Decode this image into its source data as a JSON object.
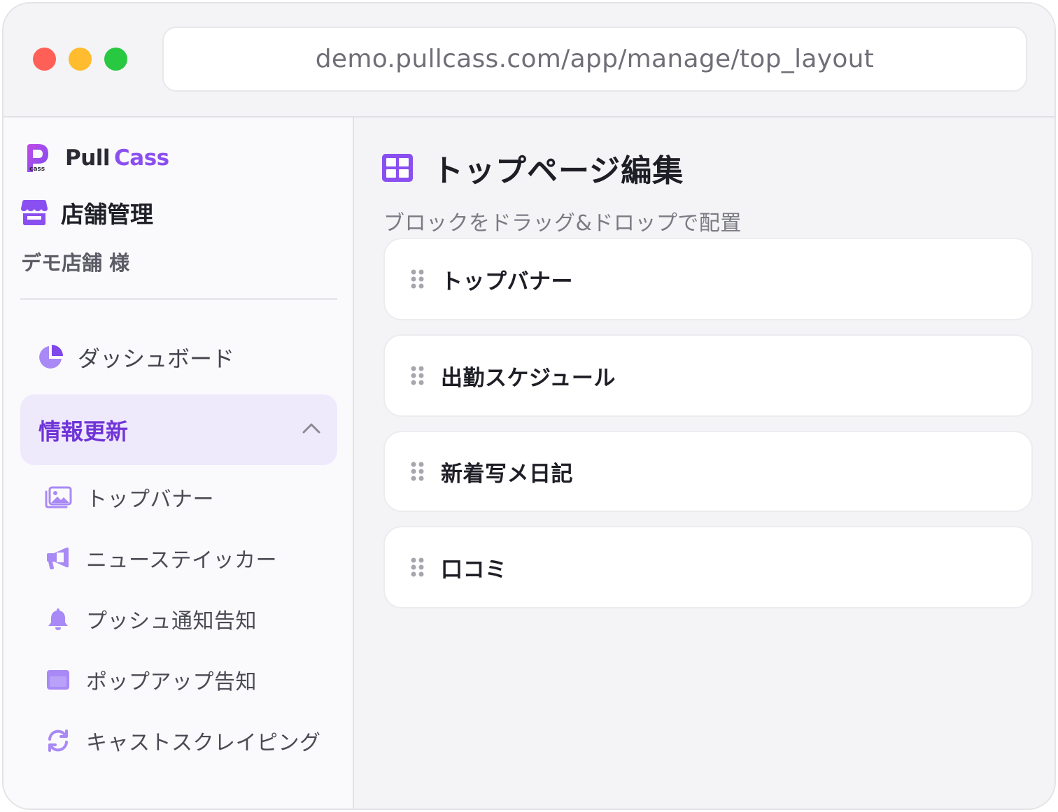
{
  "browser": {
    "url": "demo.pullcass.com/app/manage/top_layout"
  },
  "sidebar": {
    "brand": {
      "pull": "Pull",
      "cass": "Cass",
      "logo_icon": "pullcass-logo",
      "logo_caption": "cass"
    },
    "store_title": "店舗管理",
    "store_user": "デモ店舗 様",
    "dashboard": {
      "label": "ダッシュボード",
      "icon": "pie-chart-icon"
    },
    "group": {
      "label": "情報更新",
      "expanded": true,
      "icon": "chevron-up-icon"
    },
    "items": [
      {
        "label": "トップバナー",
        "icon": "images-icon"
      },
      {
        "label": "ニューステイッカー",
        "icon": "megaphone-icon"
      },
      {
        "label": "プッシュ通知告知",
        "icon": "bell-icon"
      },
      {
        "label": "ポップアップ告知",
        "icon": "window-icon"
      },
      {
        "label": "キャストスクレイピング",
        "icon": "sync-icon"
      }
    ]
  },
  "main": {
    "title": "トップページ編集",
    "title_icon": "grid-icon",
    "hint": "ブロックをドラッグ&ドロップで配置",
    "blocks": [
      {
        "label": "トップバナー"
      },
      {
        "label": "出勤スケジュール"
      },
      {
        "label": "新着写メ日記"
      },
      {
        "label": "口コミ"
      }
    ]
  },
  "colors": {
    "accent": "#7f46e8",
    "accent_light": "#a989f5",
    "active_bg": "#efe9fc",
    "active_text": "#7034d8"
  }
}
